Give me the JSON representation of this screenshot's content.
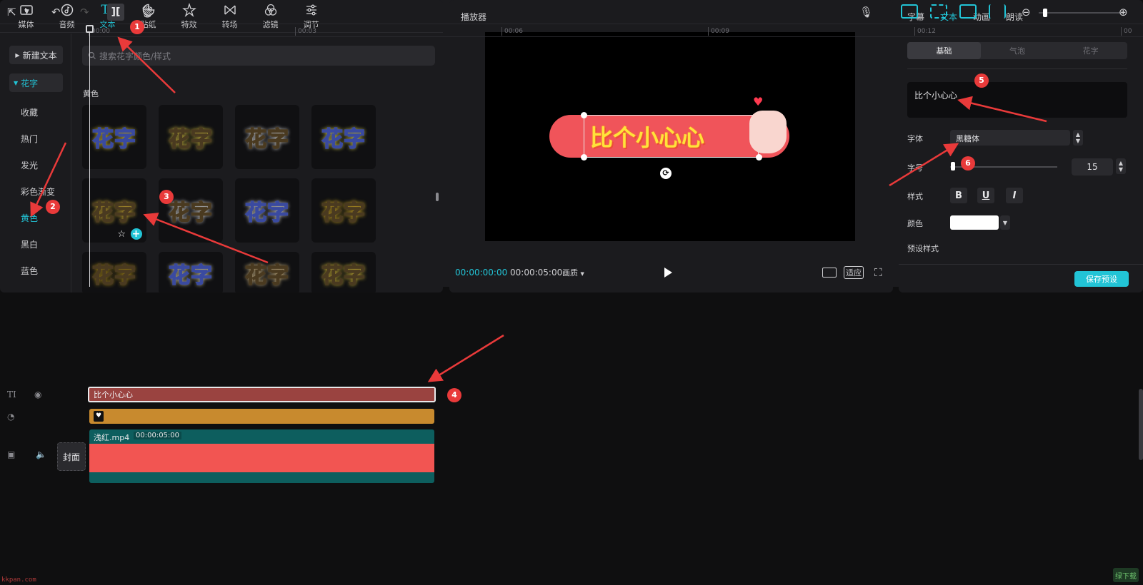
{
  "toolbar": {
    "tabs": [
      {
        "label": "媒体",
        "icon": "media-icon"
      },
      {
        "label": "音频",
        "icon": "audio-icon"
      },
      {
        "label": "文本",
        "icon": "text-icon",
        "active": true
      },
      {
        "label": "贴纸",
        "icon": "sticker-icon"
      },
      {
        "label": "特效",
        "icon": "effects-icon"
      },
      {
        "label": "转场",
        "icon": "transition-icon"
      },
      {
        "label": "滤镜",
        "icon": "filter-icon"
      },
      {
        "label": "调节",
        "icon": "adjust-icon"
      }
    ],
    "text_glyph": "TI"
  },
  "sidebar": {
    "new_text": "新建文本",
    "group": "花字",
    "items": [
      "收藏",
      "热门",
      "发光",
      "彩色渐变",
      "黄色",
      "黑白",
      "蓝色"
    ],
    "active_item": "黄色"
  },
  "search": {
    "placeholder": "搜索花字颜色/样式"
  },
  "section": {
    "title": "黄色"
  },
  "thumbnails": {
    "label": "花字",
    "count": 12,
    "colors": [
      "#ffe33a",
      "#ffe64a",
      "#ffffff",
      "#fff45a",
      "#ffd43a",
      "#ffffff",
      "#f2f2f2",
      "#ffcf2a",
      "#c9a21a",
      "#fff6c0",
      "#ffe0a0",
      "#ffe040"
    ]
  },
  "player": {
    "title": "播放器",
    "caption": "比个小心心",
    "time_current": "00:00:00:00",
    "time_total": "00:00:05:00",
    "quality": "画质",
    "fit": "适应"
  },
  "props": {
    "tabs": [
      "字幕",
      "文本",
      "动画",
      "朗读"
    ],
    "active_tab": "文本",
    "segments": [
      "基础",
      "气泡",
      "花字"
    ],
    "text_value": "比个小心心",
    "font_label": "字体",
    "font_value": "黑糖体",
    "size_label": "字号",
    "size_value": "15",
    "size_fraction": 0.02,
    "style_label": "样式",
    "style_buttons": [
      "B",
      "U",
      "I"
    ],
    "color_label": "颜色",
    "color_value": "#ffffff",
    "preset_label": "预设样式",
    "save_preset": "保存预设"
  },
  "timeline": {
    "ruler": [
      "00:00",
      "00:03",
      "00:06",
      "00:09",
      "00:12",
      "00"
    ],
    "text_clip": "比个小心心",
    "video_name": "浅红.mp4",
    "video_duration": "00:00:05:00",
    "cover": "封面",
    "zoom_fraction": 0.05
  },
  "annotations": [
    "1",
    "2",
    "3",
    "4",
    "5",
    "6"
  ],
  "watermark": {
    "left": "kkpan.com",
    "right": "绿下载"
  },
  "colors": {
    "accent": "#22c4d6",
    "panel": "#1b1b1e",
    "badge": "#e93a3a",
    "text_clip": "#9a4340",
    "sticker_clip": "#c88a2e",
    "video_clip": "#0d5e5e"
  }
}
